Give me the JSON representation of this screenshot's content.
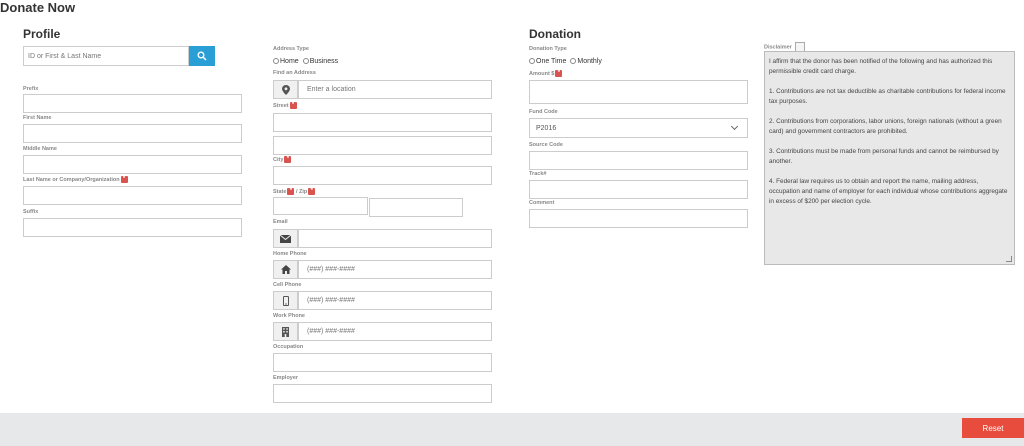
{
  "page": {
    "title": "Donate Now"
  },
  "profile": {
    "heading": "Profile",
    "search_placeholder": "ID or First & Last Name",
    "prefix_label": "Prefix",
    "first_name_label": "First Name",
    "middle_name_label": "Middle Name",
    "last_name_label": "Last Name or Company/Organization",
    "suffix_label": "Suffix"
  },
  "address": {
    "type_label": "Address Type",
    "type_options": [
      "Home",
      "Business"
    ],
    "find_label": "Find an Address",
    "find_placeholder": "Enter a location",
    "street_label": "Street",
    "city_label": "City",
    "state_label": "State",
    "zip_label": "/ Zip",
    "email_label": "Email",
    "home_phone_label": "Home Phone",
    "cell_phone_label": "Cell Phone",
    "work_phone_label": "Work Phone",
    "phone_placeholder": "(###) ###-####",
    "occupation_label": "Occupation",
    "employer_label": "Employer"
  },
  "donation": {
    "heading": "Donation",
    "type_label": "Donation Type",
    "type_options": [
      "One Time",
      "Monthly"
    ],
    "amount_label": "Amount $",
    "fund_code_label": "Fund Code",
    "fund_code_value": "P2016",
    "source_code_label": "Source Code",
    "track_label": "Track#",
    "comment_label": "Comment"
  },
  "disclaimer": {
    "label": "Disclaimer",
    "paragraphs": [
      "I affirm that the donor has been notified of the following and has authorized this permissible credit card charge.",
      "1. Contributions are not tax deductible as charitable contributions for federal income tax purposes.",
      "2. Contributions from corporations, labor unions, foreign nationals (without a green card) and government contractors are prohibited.",
      "3. Contributions must be made from personal funds and cannot be reimbursed by another.",
      "4. Federal law requires us to obtain and report the name, mailing address, occupation and name of employer for each individual whose contributions aggregate in excess of $200 per election cycle."
    ]
  },
  "footer": {
    "reset_label": "Reset"
  },
  "required_marker": "*",
  "colors": {
    "accent": "#2a9fd6",
    "danger": "#e74c3c",
    "required": "#d9534f"
  },
  "icons": {
    "search": "search-icon",
    "location": "map-pin-icon",
    "email": "envelope-icon",
    "home": "home-icon",
    "cell": "mobile-icon",
    "work": "building-icon"
  }
}
